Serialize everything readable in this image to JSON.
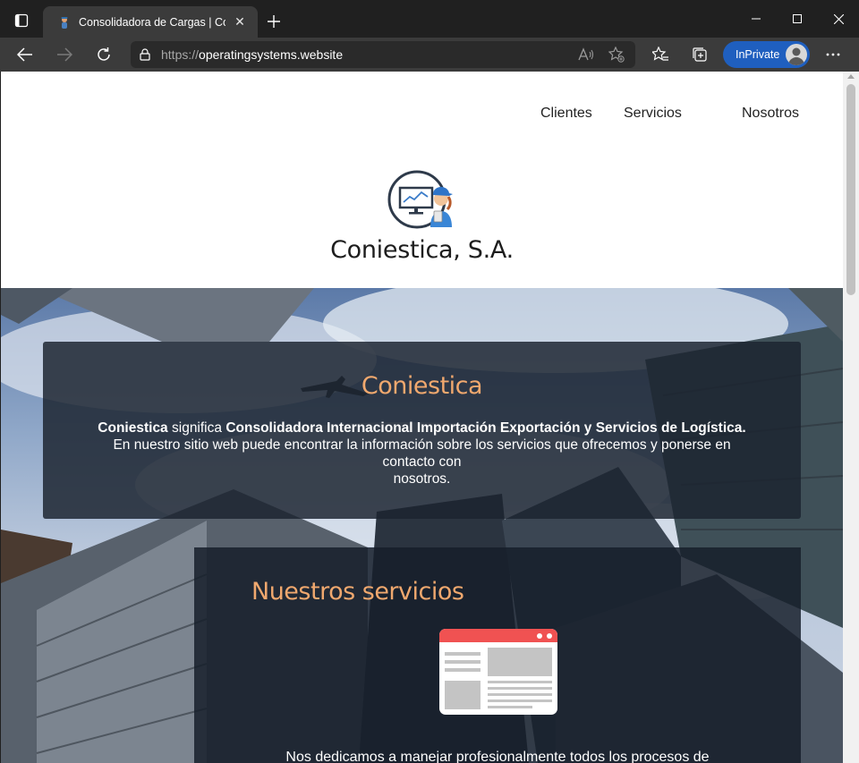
{
  "browser": {
    "tab_title": "Consolidadora de Cargas | Coniestica",
    "url_scheme": "https://",
    "url_host": "operatingsystems.website",
    "inprivate_label": "InPrivate"
  },
  "nav": {
    "items": [
      {
        "label": "Clientes"
      },
      {
        "label": "Servicios"
      },
      {
        "label": "Nosotros"
      }
    ]
  },
  "brand": {
    "name": "Coniestica, S.A."
  },
  "intro": {
    "title": "Coniestica",
    "brand_word": "Coniestica",
    "meaning_prefix": "significa",
    "meaning": "Consolidadora Internacional Importación Exportación y Servicios de Logística.",
    "line2": "En nuestro sitio web puede encontrar la información sobre los servicios que ofrecemos y ponerse en contacto con",
    "line3": "nosotros."
  },
  "services": {
    "title": "Nuestros servicios",
    "description": "Nos dedicamos a manejar profesionalmente todos los procesos de"
  },
  "colors": {
    "accent_heading": "#f0a86e",
    "inprivate_blue": "#1f5fbf",
    "panel_bg": "#1c2430"
  }
}
